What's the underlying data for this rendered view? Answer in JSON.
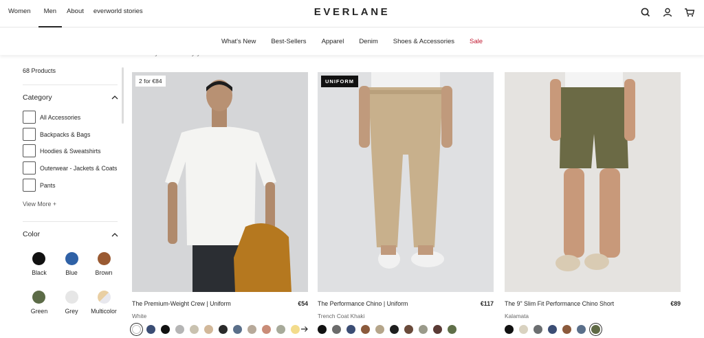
{
  "top_nav": [
    "Women",
    "Men",
    "About",
    "everworld stories"
  ],
  "brand": "EVERLANE",
  "icons": [
    "search-icon",
    "account-icon",
    "cart-icon"
  ],
  "category_nav": [
    "What's New",
    "Best-Sellers",
    "Apparel",
    "Denim",
    "Shoes & Accessories",
    "Sale"
  ],
  "peek_text": "made by as loved by you.",
  "filters": {
    "product_count": "68 Products",
    "category_title": "Category",
    "categories": [
      "All Accessories",
      "Backpacks & Bags",
      "Hoodies & Sweatshirts",
      "Outerwear - Jackets & Coats",
      "Pants"
    ],
    "view_more": "View More +",
    "color_title": "Color",
    "colors": [
      {
        "name": "Black",
        "hex": "#111111"
      },
      {
        "name": "Blue",
        "hex": "#2f61a6"
      },
      {
        "name": "Brown",
        "hex": "#9a5a32"
      },
      {
        "name": "Green",
        "hex": "#5c6b47"
      },
      {
        "name": "Grey",
        "hex": "#e6e6e6"
      },
      {
        "name": "Multicolor",
        "hex": "multicolor"
      }
    ]
  },
  "products": [
    {
      "badge": "2 for €84",
      "name": "The Premium-Weight Crew | Uniform",
      "price": "€54",
      "color": "White",
      "swatches": [
        "#ffffff",
        "#3b4d74",
        "#111111",
        "#b5b5b5",
        "#c9c2b0",
        "#d2b89a",
        "#2a2a2a",
        "#5a6f8a",
        "#b7a99a",
        "#c98c78",
        "#a7aa9a",
        "#f3dc8c"
      ]
    },
    {
      "badge": "UNIFORM",
      "name": "The Performance Chino | Uniform",
      "price": "€117",
      "color": "Trench Coat Khaki",
      "swatches": [
        "#111111",
        "#6b6b6b",
        "#3b4d74",
        "#8b5a3c",
        "#b5a58a",
        "#1e1e1e",
        "#6a4a3a",
        "#9a9a8a",
        "#5a3a35",
        "#5f6f48"
      ]
    },
    {
      "badge": "",
      "name": "The 9\" Slim Fit Performance Chino Short",
      "price": "€89",
      "color": "Kalamata",
      "swatches": [
        "#111111",
        "#d9d2c0",
        "#6b6e70",
        "#3b4d74",
        "#8b5a3c",
        "#5a6f8a",
        "#5f6a45"
      ]
    }
  ]
}
